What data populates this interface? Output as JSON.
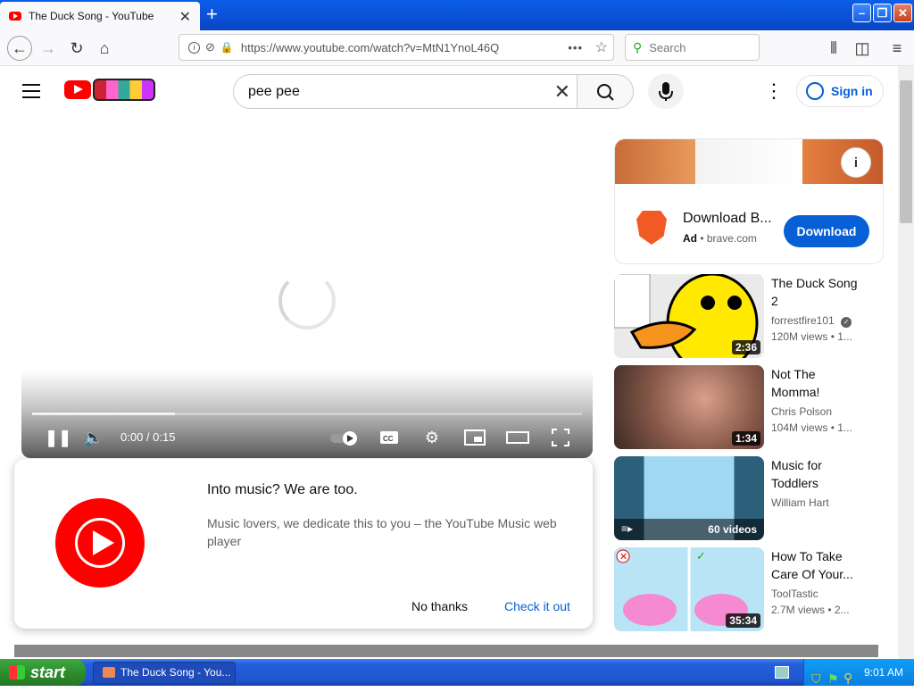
{
  "browser": {
    "tab_title": "The Duck Song - YouTube",
    "url": "https://www.youtube.com/watch?v=MtN1YnoL46Q",
    "url_domain": "youtube.com",
    "search_placeholder": "Search"
  },
  "youtube": {
    "search_value": "pee pee",
    "sign_in": "Sign in",
    "player": {
      "time": "0:00 / 0:15",
      "loaded_fraction": 0.26
    },
    "popup": {
      "title": "Into music? We are too.",
      "description": "Music lovers, we dedicate this to you – the YouTube Music web player",
      "no_thanks": "No thanks",
      "check_it_out": "Check it out"
    },
    "ad": {
      "title": "Download B...",
      "label": "Ad",
      "domain": "brave.com",
      "button": "Download"
    },
    "related": [
      {
        "title": "The Duck Song 2",
        "channel": "forrestfire101",
        "views": "120M views • 1...",
        "duration": "2:36",
        "verified": true
      },
      {
        "title": "Not The Momma!",
        "channel": "Chris Polson",
        "views": "104M views • 1...",
        "duration": "1:34"
      },
      {
        "title": "Music for Toddlers",
        "channel": "William Hart",
        "views": "",
        "duration": "60 videos"
      },
      {
        "title": "How To Take Care Of Your...",
        "channel": "ToolTastic",
        "views": "2.7M views • 2...",
        "duration": "35:34"
      }
    ]
  },
  "taskbar": {
    "start": "start",
    "window_item": "The Duck Song - You...",
    "clock": "9:01 AM"
  },
  "colors": {
    "brand_red": "#ff0000",
    "link_blue": "#065fd4",
    "xp_blue": "#245edb"
  }
}
